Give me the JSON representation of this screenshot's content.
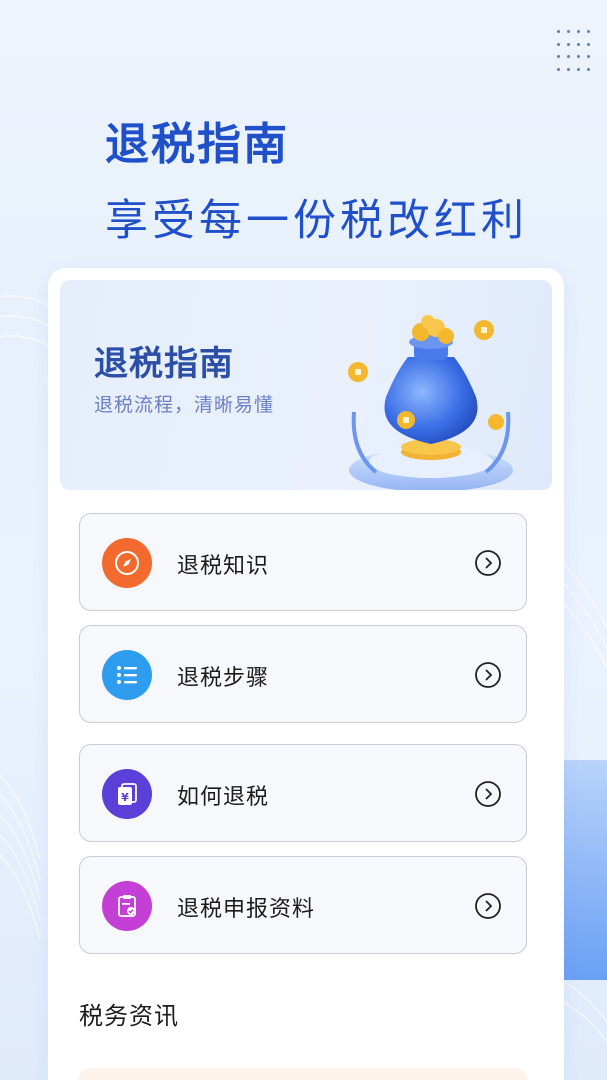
{
  "hero": {
    "title": "退税指南",
    "subtitle": "享受每一份税改红利"
  },
  "banner": {
    "title": "退税指南",
    "subtitle": "退税流程，清晰易懂"
  },
  "menu": [
    {
      "label": "退税知识",
      "icon": "compass-icon",
      "color": "#f26a2e"
    },
    {
      "label": "退税步骤",
      "icon": "list-icon",
      "color": "#2e9df0"
    },
    {
      "label": "如何退税",
      "icon": "yuan-document-icon",
      "color": "#5a3fd9"
    },
    {
      "label": "退税申报资料",
      "icon": "clipboard-check-icon",
      "color": "#c33fd6"
    }
  ],
  "news": {
    "title": "税务资讯"
  },
  "colors": {
    "accent": "#1f4fc9",
    "card_bg": "#ffffff"
  }
}
